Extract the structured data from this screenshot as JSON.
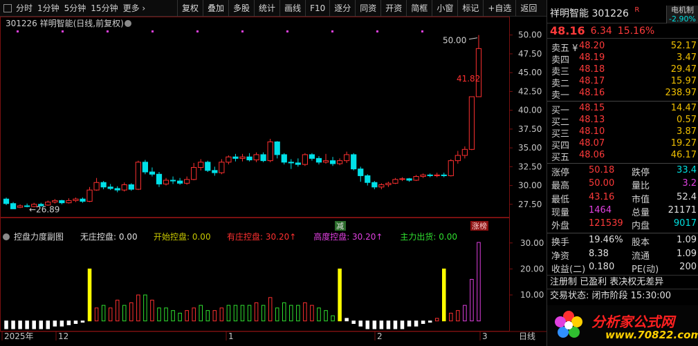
{
  "toolbar": {
    "periods": [
      "分时",
      "1分钟",
      "5分钟",
      "15分钟",
      "更多 ›"
    ],
    "buttons": [
      "复权",
      "叠加",
      "多股",
      "统计",
      "画线",
      "F10",
      "逐分",
      "同资",
      "开资",
      "简框",
      "小窗",
      "标记",
      "+自选",
      "返回"
    ]
  },
  "chart_header": {
    "title": "301226  祥明智能(日线,前复权)",
    "max_label": "50.00",
    "min_label": "26.89",
    "mid_label": "41.82",
    "tag_jian": "减",
    "tag_zhangbang": "涨榜"
  },
  "indicator": {
    "title": "控盘力度副图",
    "items": [
      {
        "label": "无庄控盘:",
        "value": "0.00",
        "color": "#e0e0e0"
      },
      {
        "label": "开始控盘:",
        "value": "0.00",
        "color": "#c8c800"
      },
      {
        "label": "有庄控盘:",
        "value": "30.20↑",
        "color": "#ff3030"
      },
      {
        "label": "高度控盘:",
        "value": "30.20↑",
        "color": "#e040e0"
      },
      {
        "label": "主力出货:",
        "value": "0.00",
        "color": "#30e030"
      }
    ]
  },
  "xaxis": {
    "labels": [
      "2025年",
      "12",
      "1",
      "2",
      "3"
    ],
    "right_label": "日线"
  },
  "chart_data": {
    "type": "candlestick",
    "price_axis": {
      "ticks": [
        "50.00",
        "47.50",
        "45.00",
        "42.50",
        "40.00",
        "37.50",
        "35.00",
        "32.50",
        "30.00",
        "27.50"
      ],
      "ylim": [
        26.2,
        50.8
      ]
    },
    "candles": [
      [
        28.2,
        27.6,
        28.4,
        27.4
      ],
      [
        27.6,
        26.9,
        27.8,
        26.89
      ],
      [
        27.1,
        27.3,
        27.5,
        27.0
      ],
      [
        27.3,
        27.2,
        27.6,
        27.1
      ],
      [
        27.2,
        27.5,
        27.7,
        27.1
      ],
      [
        27.5,
        27.3,
        27.7,
        27.2
      ],
      [
        27.4,
        27.8,
        28.0,
        27.3
      ],
      [
        27.8,
        28.0,
        28.2,
        27.6
      ],
      [
        28.0,
        27.7,
        28.1,
        27.5
      ],
      [
        27.7,
        28.0,
        28.3,
        27.6
      ],
      [
        28.0,
        28.2,
        28.4,
        27.8
      ],
      [
        28.2,
        27.9,
        28.4,
        27.7
      ],
      [
        27.9,
        29.4,
        29.8,
        27.8
      ],
      [
        29.4,
        30.4,
        31.0,
        29.3
      ],
      [
        30.4,
        29.8,
        30.6,
        29.5
      ],
      [
        29.8,
        29.6,
        30.2,
        29.4
      ],
      [
        29.6,
        29.4,
        29.9,
        29.1
      ],
      [
        29.4,
        30.1,
        30.4,
        29.2
      ],
      [
        30.1,
        29.5,
        30.3,
        29.3
      ],
      [
        29.5,
        33.1,
        33.3,
        29.4
      ],
      [
        33.1,
        31.8,
        33.4,
        31.5
      ],
      [
        31.8,
        31.5,
        32.4,
        31.2
      ],
      [
        31.5,
        30.2,
        31.8,
        29.8
      ],
      [
        30.2,
        30.7,
        31.0,
        30.0
      ],
      [
        30.7,
        30.6,
        31.2,
        30.2
      ],
      [
        30.6,
        30.3,
        31.0,
        30.1
      ],
      [
        30.3,
        30.8,
        31.2,
        30.1
      ],
      [
        30.8,
        32.4,
        33.0,
        30.7
      ],
      [
        32.4,
        33.1,
        33.5,
        32.0
      ],
      [
        33.1,
        32.0,
        33.3,
        31.8
      ],
      [
        32.0,
        31.7,
        32.5,
        31.3
      ],
      [
        31.7,
        33.1,
        33.5,
        31.5
      ],
      [
        33.1,
        33.8,
        34.0,
        32.8
      ],
      [
        33.8,
        33.6,
        34.2,
        33.2
      ],
      [
        33.6,
        33.8,
        34.2,
        33.2
      ],
      [
        33.8,
        33.4,
        34.3,
        33.2
      ],
      [
        33.4,
        34.1,
        34.4,
        33.1
      ],
      [
        34.1,
        33.3,
        34.4,
        33.1
      ],
      [
        33.3,
        35.8,
        36.2,
        33.1
      ],
      [
        35.8,
        34.1,
        35.9,
        33.6
      ],
      [
        34.1,
        33.1,
        34.3,
        32.8
      ],
      [
        33.1,
        33.0,
        33.5,
        32.2
      ],
      [
        33.0,
        32.8,
        33.6,
        32.5
      ],
      [
        32.8,
        34.1,
        34.3,
        32.6
      ],
      [
        34.1,
        33.6,
        34.3,
        33.3
      ],
      [
        33.6,
        33.1,
        33.9,
        32.8
      ],
      [
        33.1,
        33.3,
        34.2,
        32.9
      ],
      [
        33.3,
        32.9,
        33.8,
        32.6
      ],
      [
        32.9,
        33.3,
        33.6,
        32.7
      ],
      [
        33.3,
        34.1,
        34.5,
        33.0
      ],
      [
        34.1,
        32.2,
        34.3,
        32.0
      ],
      [
        32.2,
        31.3,
        32.5,
        30.5
      ],
      [
        31.3,
        30.4,
        31.5,
        30.0
      ],
      [
        30.4,
        29.8,
        30.6,
        29.5
      ],
      [
        29.8,
        30.1,
        30.3,
        29.5
      ],
      [
        30.1,
        30.3,
        30.5,
        29.8
      ],
      [
        30.3,
        30.8,
        31.0,
        30.2
      ],
      [
        30.8,
        30.9,
        31.1,
        30.6
      ],
      [
        30.9,
        30.7,
        31.0,
        30.5
      ],
      [
        30.7,
        31.2,
        31.4,
        30.6
      ],
      [
        31.2,
        31.4,
        31.6,
        31.0
      ],
      [
        31.4,
        31.3,
        31.6,
        31.1
      ],
      [
        31.3,
        31.4,
        31.7,
        31.1
      ],
      [
        31.4,
        31.3,
        31.7,
        31.1
      ],
      [
        31.3,
        33.3,
        33.5,
        31.2
      ],
      [
        33.3,
        34.0,
        34.6,
        32.9
      ],
      [
        34.0,
        34.8,
        35.2,
        33.6
      ],
      [
        34.8,
        41.8,
        41.82,
        34.7
      ],
      [
        41.8,
        48.2,
        50.0,
        43.16
      ]
    ],
    "ind_axis": {
      "ticks": [
        "30.00",
        "20.00",
        "10.00"
      ],
      "ylim": [
        -3,
        31
      ]
    },
    "ind_values": [
      [
        -3,
        "w"
      ],
      [
        -3,
        "w"
      ],
      [
        -3,
        "w"
      ],
      [
        -3,
        "w"
      ],
      [
        -3,
        "w"
      ],
      [
        -3,
        "w"
      ],
      [
        -3,
        "w"
      ],
      [
        -2,
        "w"
      ],
      [
        -2,
        "w"
      ],
      [
        -1.5,
        "w"
      ],
      [
        -1,
        "w"
      ],
      [
        -0.5,
        "w"
      ],
      [
        20,
        "y"
      ],
      [
        5,
        "r"
      ],
      [
        6,
        "g"
      ],
      [
        5,
        "r"
      ],
      [
        8,
        "r"
      ],
      [
        6,
        "g"
      ],
      [
        7,
        "r"
      ],
      [
        10,
        "r"
      ],
      [
        10,
        "g"
      ],
      [
        8,
        "r"
      ],
      [
        5,
        "g"
      ],
      [
        5,
        "g"
      ],
      [
        4,
        "g"
      ],
      [
        3,
        "g"
      ],
      [
        4,
        "r"
      ],
      [
        5,
        "r"
      ],
      [
        6,
        "g"
      ],
      [
        4,
        "g"
      ],
      [
        4,
        "r"
      ],
      [
        5,
        "r"
      ],
      [
        6,
        "g"
      ],
      [
        6,
        "g"
      ],
      [
        6,
        "g"
      ],
      [
        6,
        "g"
      ],
      [
        7,
        "r"
      ],
      [
        6,
        "g"
      ],
      [
        9,
        "r"
      ],
      [
        5,
        "g"
      ],
      [
        7,
        "g"
      ],
      [
        6,
        "g"
      ],
      [
        6,
        "g"
      ],
      [
        7,
        "r"
      ],
      [
        6,
        "r"
      ],
      [
        5,
        "g"
      ],
      [
        4,
        "g"
      ],
      [
        2,
        "g"
      ],
      [
        20,
        "y"
      ],
      [
        1,
        "w"
      ],
      [
        -1,
        "w"
      ],
      [
        -2,
        "w"
      ],
      [
        -3,
        "w"
      ],
      [
        -3,
        "w"
      ],
      [
        -3,
        "w"
      ],
      [
        -3,
        "w"
      ],
      [
        -3,
        "w"
      ],
      [
        -3,
        "w"
      ],
      [
        -2,
        "w"
      ],
      [
        -2,
        "w"
      ],
      [
        -1,
        "w"
      ],
      [
        -0.5,
        "w"
      ],
      [
        1,
        "r"
      ],
      [
        20,
        "y"
      ],
      [
        3,
        "r"
      ],
      [
        4,
        "r"
      ],
      [
        6,
        "m"
      ],
      [
        16,
        "m"
      ],
      [
        30.2,
        "m"
      ]
    ]
  },
  "panel": {
    "name": "祥明智能",
    "code": "301226",
    "r_mark": "R",
    "industry": "电机制",
    "industry_pct": "-2.90%",
    "price": "48.16",
    "change": "6.34",
    "pct": "15.16%",
    "asks": [
      {
        "label": "卖五 ¥",
        "price": "48.20",
        "vol": "52.17"
      },
      {
        "label": "卖四",
        "price": "48.19",
        "vol": "3.47"
      },
      {
        "label": "卖三",
        "price": "48.18",
        "vol": "29.47"
      },
      {
        "label": "卖二",
        "price": "48.17",
        "vol": "15.97"
      },
      {
        "label": "卖一",
        "price": "48.16",
        "vol": "238.97"
      }
    ],
    "bids": [
      {
        "label": "买一",
        "price": "48.15",
        "vol": "14.47"
      },
      {
        "label": "买二",
        "price": "48.13",
        "vol": "0.57"
      },
      {
        "label": "买三",
        "price": "48.10",
        "vol": "3.87"
      },
      {
        "label": "买四",
        "price": "48.07",
        "vol": "19.27"
      },
      {
        "label": "买五",
        "price": "48.06",
        "vol": "46.17"
      }
    ],
    "stats": [
      {
        "l1": "涨停",
        "v1": "50.18",
        "c1": "c-red",
        "l2": "跌停",
        "v2": "33.4",
        "c2": "c-cyan"
      },
      {
        "l1": "最高",
        "v1": "50.00",
        "c1": "c-red",
        "l2": "量比",
        "v2": "3.2",
        "c2": "c-mag"
      },
      {
        "l1": "最低",
        "v1": "43.16",
        "c1": "c-red",
        "l2": "市值",
        "v2": "52.4",
        "c2": "c-wht"
      },
      {
        "l1": "现量",
        "v1": "1464",
        "c1": "c-mag",
        "l2": "总量",
        "v2": "21171",
        "c2": "c-wht"
      },
      {
        "l1": "外盘",
        "v1": "121539",
        "c1": "c-red",
        "l2": "内盘",
        "v2": "9017",
        "c2": "c-cyan"
      }
    ],
    "stats2": [
      {
        "l1": "换手",
        "v1": "19.46%",
        "l2": "股本",
        "v2": "1.09"
      },
      {
        "l1": "净资",
        "v1": "8.38",
        "l2": "流通",
        "v2": "1.09"
      },
      {
        "l1": "收益(二)",
        "v1": "0.180",
        "l2": "PE(动)",
        "v2": "200"
      }
    ],
    "note1": "注册制 已盈利 表决权无差异",
    "note2": "交易状态: 闭市阶段 15:30:00",
    "logo_text": "分析家公式网",
    "logo_url": "www.70822.com"
  }
}
